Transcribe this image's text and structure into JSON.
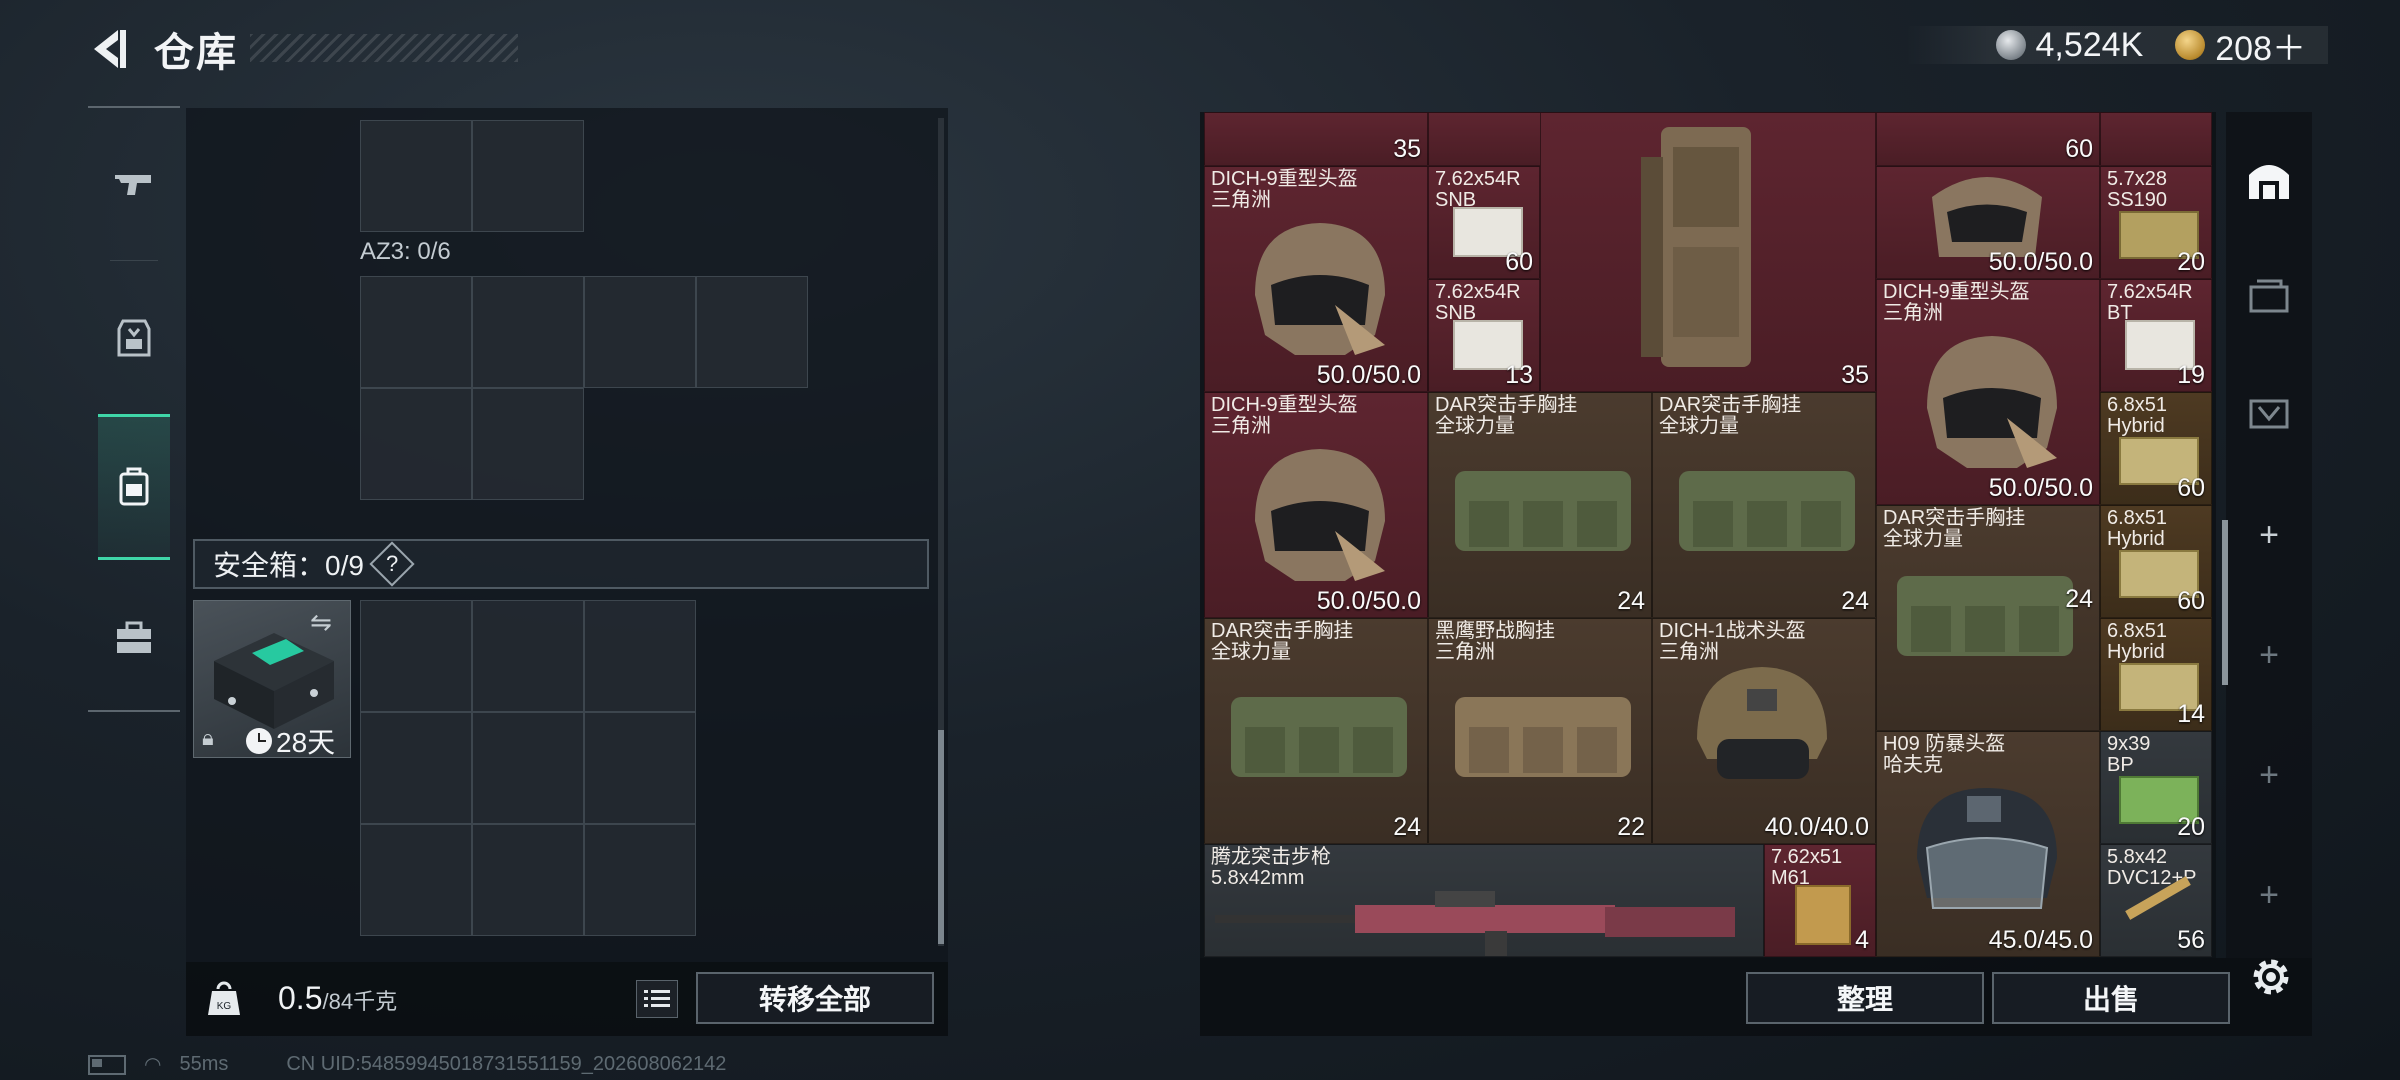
{
  "header": {
    "title": "仓库",
    "silver_amount": "4,524K",
    "gold_amount": "208＋"
  },
  "left_rail": {
    "items": [
      {
        "name": "gun-icon"
      },
      {
        "name": "armor-icon"
      },
      {
        "name": "backpack-icon",
        "active": true
      },
      {
        "name": "toolbox-icon"
      }
    ]
  },
  "left_panel": {
    "az3_label": "AZ3: 0/6",
    "safebox_label": "安全箱：0/9",
    "safebox_help": "?",
    "safebox_item_time": "28天"
  },
  "bottom_left": {
    "weight_value": "0.5",
    "weight_capacity": "/84千克",
    "transfer_all": "转移全部"
  },
  "status": {
    "ping": "55ms",
    "uid": "CN UID:54859945018731551159_202608062142"
  },
  "grid": {
    "tiles": [
      {
        "name": "",
        "value": "35"
      },
      {
        "name": "",
        "value": "60"
      },
      {
        "name": "DICH-9重型头盔\n三角洲",
        "value": "50.0/50.0"
      },
      {
        "name": "7.62x54R\nSNB",
        "value": "60"
      },
      {
        "name": "7.62x54R\nSNB",
        "value": "13"
      },
      {
        "name": "",
        "value": "35"
      },
      {
        "name": "",
        "value": "50.0/50.0"
      },
      {
        "name": "5.7x28\nSS190",
        "value": "20"
      },
      {
        "name": "DICH-9重型头盔\n三角洲",
        "value": "50.0/50.0"
      },
      {
        "name": "7.62x54R\nBT",
        "value": "19"
      },
      {
        "name": "DICH-9重型头盔\n三角洲",
        "value": "50.0/50.0"
      },
      {
        "name": "DAR突击手胸挂\n全球力量",
        "value": "24"
      },
      {
        "name": "DAR突击手胸挂\n全球力量",
        "value": "24"
      },
      {
        "name": "6.8x51\nHybrid",
        "value": "60"
      },
      {
        "name": "DAR突击手胸挂\n全球力量",
        "value": "24"
      },
      {
        "name": "6.8x51\nHybrid",
        "value": "60"
      },
      {
        "name": "DAR突击手胸挂\n全球力量",
        "value": "24"
      },
      {
        "name": "黑鹰野战胸挂\n三角洲",
        "value": "22"
      },
      {
        "name": "DICH-1战术头盔\n三角洲",
        "value": "40.0/40.0"
      },
      {
        "name": "6.8x51\nHybrid",
        "value": "14"
      },
      {
        "name": "H09 防暴头盔\n哈夫克",
        "value": "45.0/45.0"
      },
      {
        "name": "9x39\nBP",
        "value": "20"
      },
      {
        "name": "腾龙突击步枪\n5.8x42mm",
        "value": ""
      },
      {
        "name": "7.62x51\nM61",
        "value": "4"
      },
      {
        "name": "5.8x42\nDVC12+P",
        "value": "56"
      }
    ]
  },
  "bottom_right": {
    "sort": "整理",
    "sell": "出售"
  },
  "colors": {
    "accent": "#3fd6a8",
    "tile_red": "#5e2530",
    "tile_brown": "#4b3b2e"
  }
}
